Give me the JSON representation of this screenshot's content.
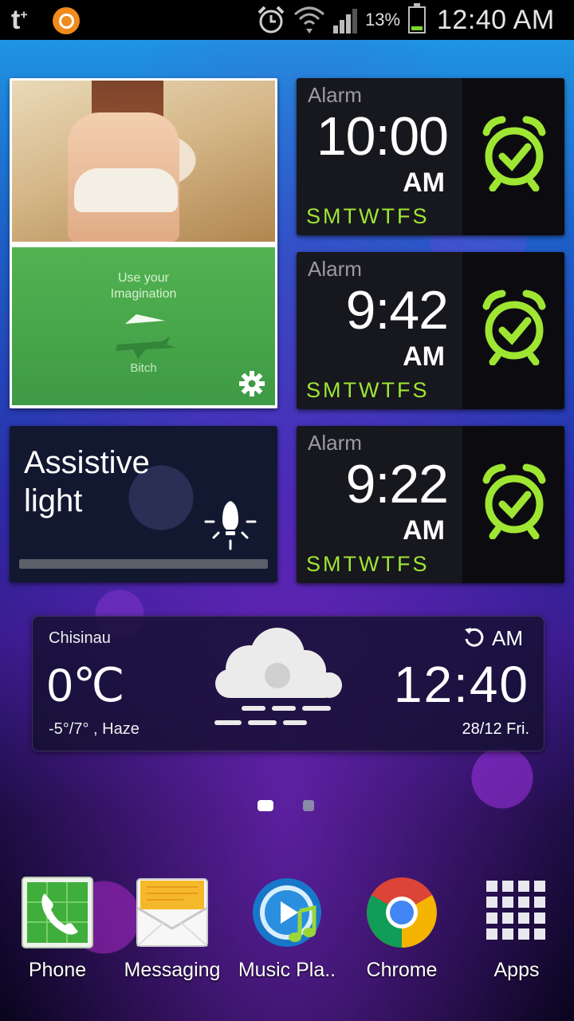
{
  "status_bar": {
    "left_icons": [
      "t-plus-icon",
      "circle-app-icon"
    ],
    "battery_percent": "13%",
    "time": "12:40 AM"
  },
  "photo_widget": {
    "card_line1": "Use your",
    "card_line2": "Imagination",
    "card_line3": "Bitch"
  },
  "alarms": [
    {
      "label": "Alarm",
      "time": "10:00",
      "ampm": "AM",
      "days": "SMTWTFS"
    },
    {
      "label": "Alarm",
      "time": "9:42",
      "ampm": "AM",
      "days": "SMTWTFS"
    },
    {
      "label": "Alarm",
      "time": "9:22",
      "ampm": "AM",
      "days": "SMTWTFS"
    }
  ],
  "assistive_light": {
    "title": "Assistive light"
  },
  "weather": {
    "city": "Chisinau",
    "temperature": "0℃",
    "details": "-5°/7° , Haze",
    "ampm": "AM",
    "time": "12:40",
    "date": "28/12 Fri."
  },
  "dock": [
    {
      "label": "Phone",
      "icon": "phone-icon"
    },
    {
      "label": "Messaging",
      "icon": "messaging-icon"
    },
    {
      "label": "Music Pla..",
      "icon": "music-player-icon"
    },
    {
      "label": "Chrome",
      "icon": "chrome-icon"
    },
    {
      "label": "Apps",
      "icon": "apps-grid-icon"
    }
  ],
  "colors": {
    "alarm_accent": "#9fe633",
    "chrome_red": "#db4437",
    "chrome_green": "#0f9d58",
    "chrome_yellow": "#f4b400",
    "chrome_blue": "#4285f4"
  }
}
